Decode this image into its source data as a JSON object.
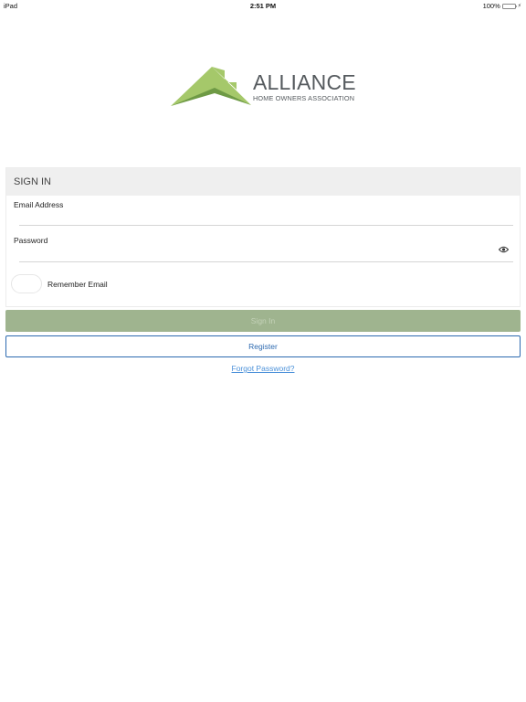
{
  "status_bar": {
    "device": "iPad",
    "time": "2:51 PM",
    "battery_text": "100%",
    "battery_level": 1.0,
    "charging_icon": "bolt-icon"
  },
  "logo": {
    "brand": "ALLIANCE",
    "tagline": "HOME OWNERS ASSOCIATION",
    "roof_color": "#a5c86a",
    "roof_shade_color": "#6e9a45",
    "text_color": "#555a5e"
  },
  "signin_card": {
    "header": "SIGN IN",
    "email_label": "Email Address",
    "email_value": "",
    "password_label": "Password",
    "password_value": "",
    "password_toggle_icon": "eye-icon",
    "remember_label": "Remember Email",
    "remember_checked": false
  },
  "actions": {
    "signin_label": "Sign In",
    "register_label": "Register",
    "forgot_label": "Forgot Password?"
  },
  "colors": {
    "signin_button_bg": "#9fb48f",
    "register_border": "#2d6ab0",
    "link": "#4a90d9"
  }
}
